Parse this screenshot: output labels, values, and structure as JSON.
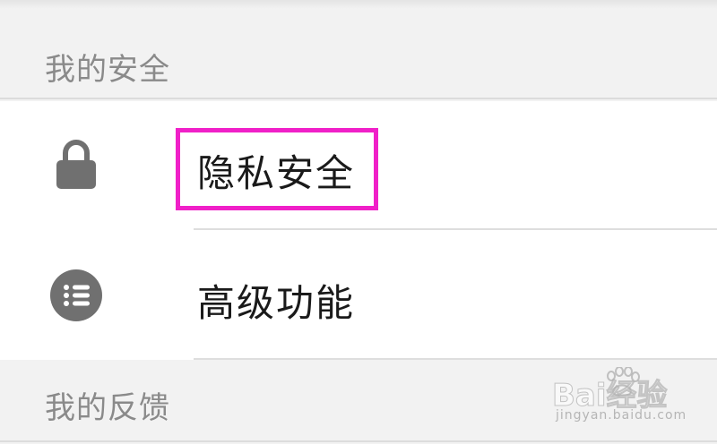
{
  "sections": {
    "security": {
      "title": "我的安全"
    },
    "feedback": {
      "title": "我的反馈"
    }
  },
  "items": {
    "privacy": {
      "label": "隐私安全",
      "icon": "lock-icon"
    },
    "advanced": {
      "label": "高级功能",
      "icon": "list-icon"
    }
  },
  "highlight": {
    "color": "#f020c8"
  },
  "watermark": {
    "brand": "Bai经验",
    "url": "jingyan.baidu.com"
  }
}
